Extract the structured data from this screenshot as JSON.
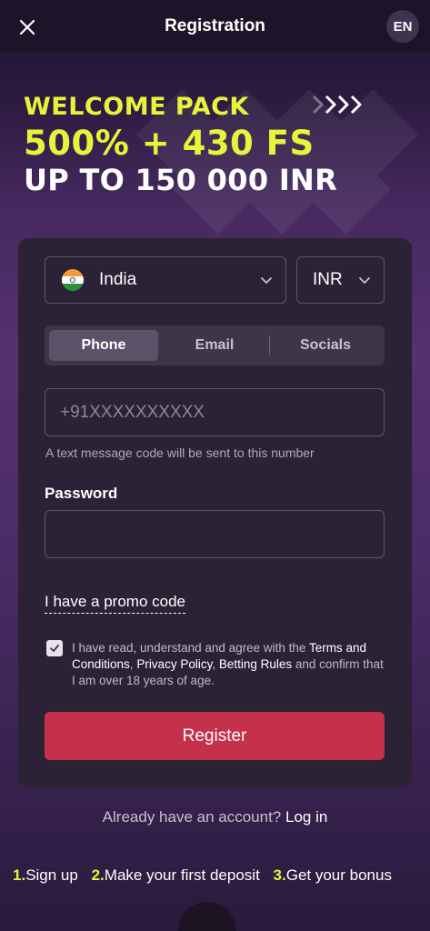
{
  "header": {
    "title": "Registration",
    "language": "EN",
    "close_icon": "close-icon"
  },
  "banner": {
    "line1": "WELCOME PACK",
    "line2": "500% + 430 FS",
    "line3": "UP TO 150 000 INR",
    "accent_color": "#e6f53a"
  },
  "form": {
    "country": "India",
    "currency": "INR",
    "tabs": [
      {
        "label": "Phone",
        "active": true
      },
      {
        "label": "Email",
        "active": false
      },
      {
        "label": "Socials",
        "active": false
      }
    ],
    "phone_placeholder": "+91XXXXXXXXXX",
    "phone_hint": "A text message code will be sent to this number",
    "password_label": "Password",
    "promo_link": "I have a promo code",
    "agree": {
      "checked": true,
      "prefix": "I have read, understand and agree with the ",
      "terms": "Terms and Conditions",
      "sep1": ", ",
      "privacy": "Privacy Policy",
      "sep2": ", ",
      "rules": "Betting Rules",
      "suffix": " and confirm that I am over 18 years of age."
    },
    "register_label": "Register",
    "register_color": "#c5304b"
  },
  "footer": {
    "login_prompt": "Already have an account? ",
    "login_link": "Log in",
    "steps": [
      {
        "num": "1.",
        "label": "Sign up"
      },
      {
        "num": "2.",
        "label": "Make your first deposit"
      },
      {
        "num": "3.",
        "label": "Get your bonus"
      }
    ]
  }
}
